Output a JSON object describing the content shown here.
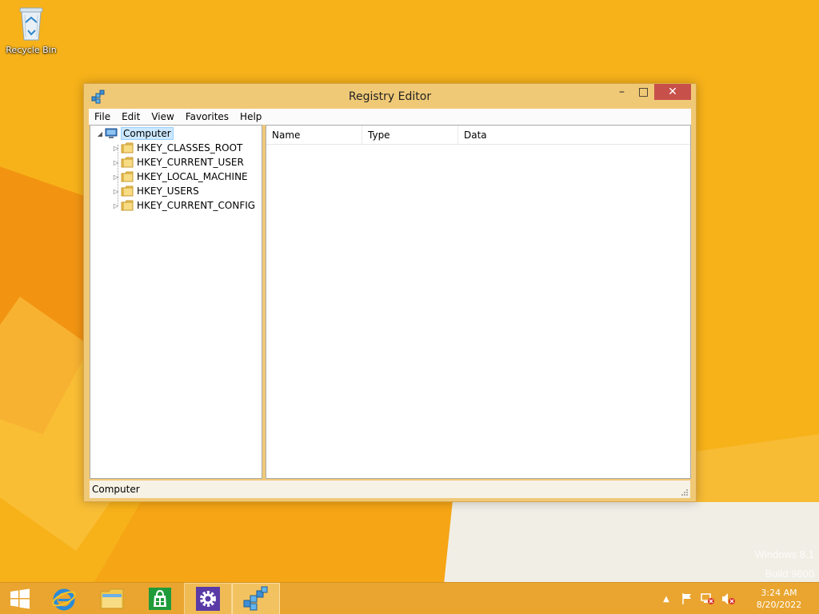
{
  "desktop": {
    "recycle_bin_label": "Recycle Bin",
    "watermark_line1": "Windows 8.1",
    "watermark_line2": "Build 9600"
  },
  "window": {
    "title": "Registry Editor",
    "buttons": {
      "minimize": "–",
      "maximize": "□",
      "close": "✕"
    },
    "menu": [
      "File",
      "Edit",
      "View",
      "Favorites",
      "Help"
    ],
    "tree": {
      "root": "Computer",
      "children": [
        "HKEY_CLASSES_ROOT",
        "HKEY_CURRENT_USER",
        "HKEY_LOCAL_MACHINE",
        "HKEY_USERS",
        "HKEY_CURRENT_CONFIG"
      ]
    },
    "list": {
      "columns": [
        "Name",
        "Type",
        "Data"
      ]
    },
    "status": "Computer"
  },
  "taskbar": {
    "clock_time": "3:24 AM",
    "clock_date": "8/20/2022",
    "icons": [
      "windows-logo-icon",
      "internet-explorer-icon",
      "file-explorer-icon",
      "store-icon",
      "settings-icon",
      "registry-editor-icon"
    ]
  },
  "colors": {
    "wallpaper": "#f7b21a",
    "window_frame": "#f0c977",
    "close_button": "#c7504b",
    "taskbar": "#e9a530",
    "selection": "#cce8ff"
  }
}
